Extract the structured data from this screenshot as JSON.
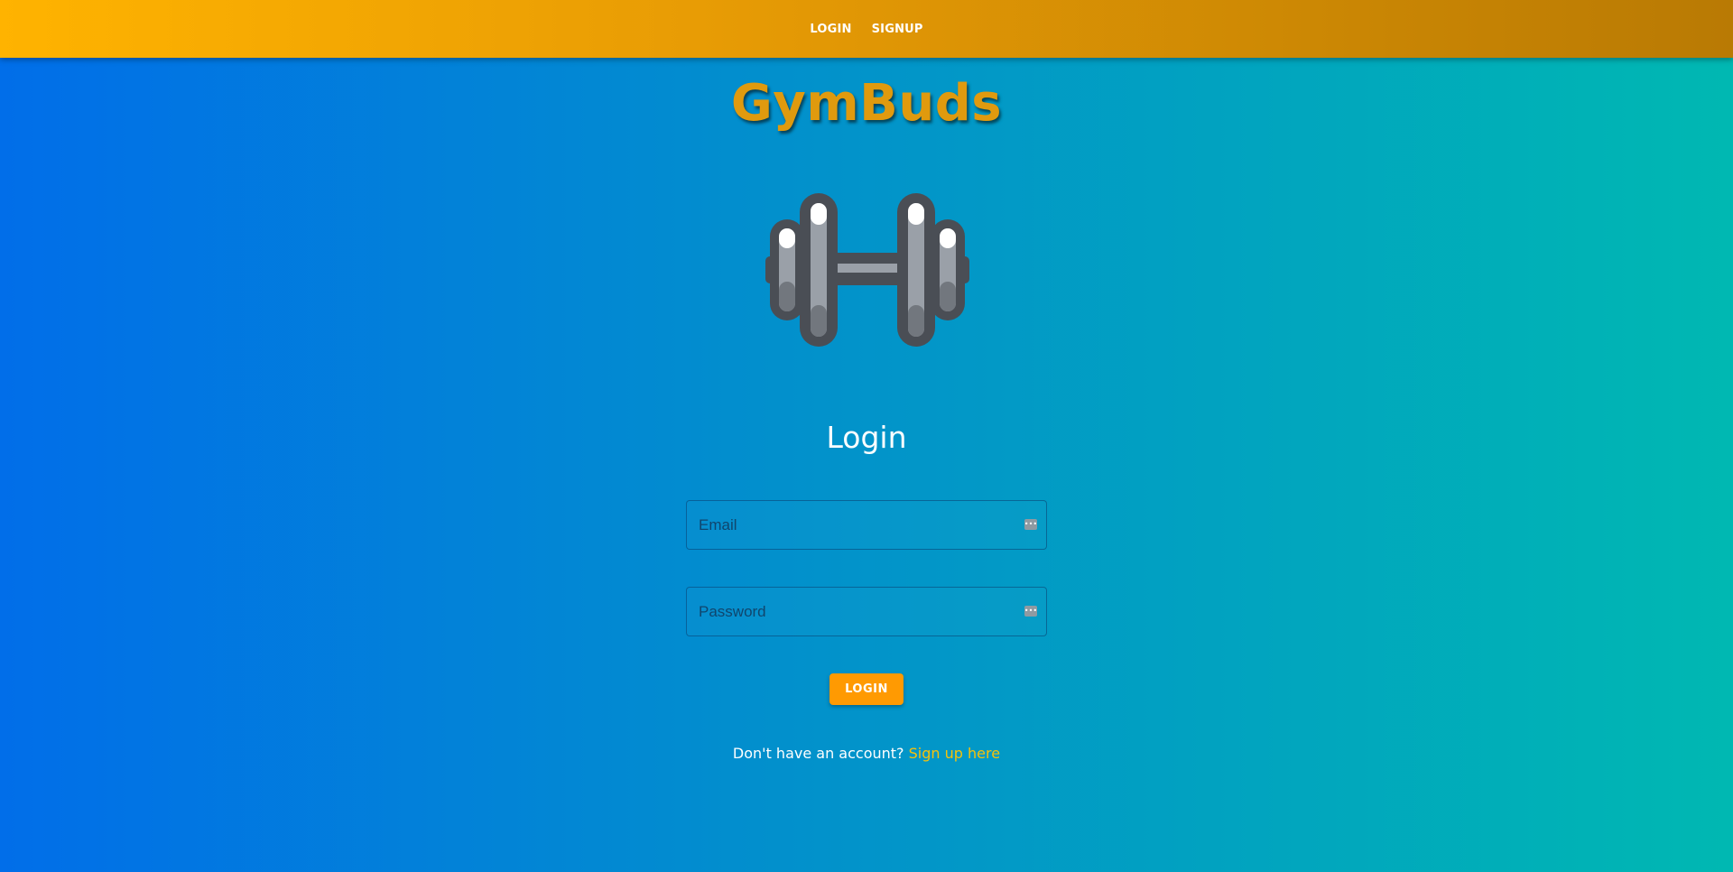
{
  "nav": {
    "login": "LOGIN",
    "signup": "SIGNUP"
  },
  "brand": {
    "title": "GymBuds",
    "logo_icon": "dumbbell-icon"
  },
  "form": {
    "heading": "Login",
    "email_placeholder": "Email",
    "password_placeholder": "Password",
    "field_icon": "password-manager-icon",
    "submit_label": "LOGIN"
  },
  "footer": {
    "prompt": "Don't have an account?",
    "link": "Sign up here"
  },
  "colors": {
    "topbar_start": "#ffb300",
    "topbar_end": "#b97a04",
    "bg_start": "#016ee9",
    "bg_end": "#00b8b2",
    "brand": "#e09a0e",
    "button": "#ff9a02",
    "link": "#f7c20a"
  }
}
